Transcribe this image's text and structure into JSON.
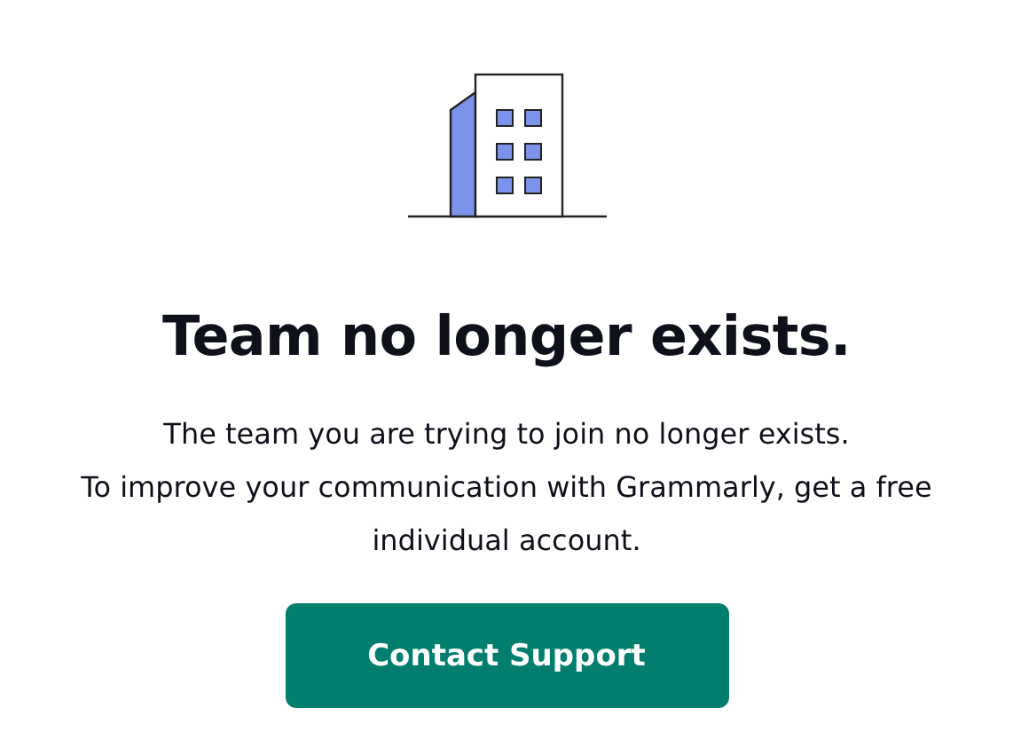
{
  "title": "Team no longer exists.",
  "paragraphs": [
    "The team you are trying to join no longer exists.",
    "To improve your communication with Grammarly, get a free individual account."
  ],
  "button": {
    "label": "Contact Support"
  }
}
